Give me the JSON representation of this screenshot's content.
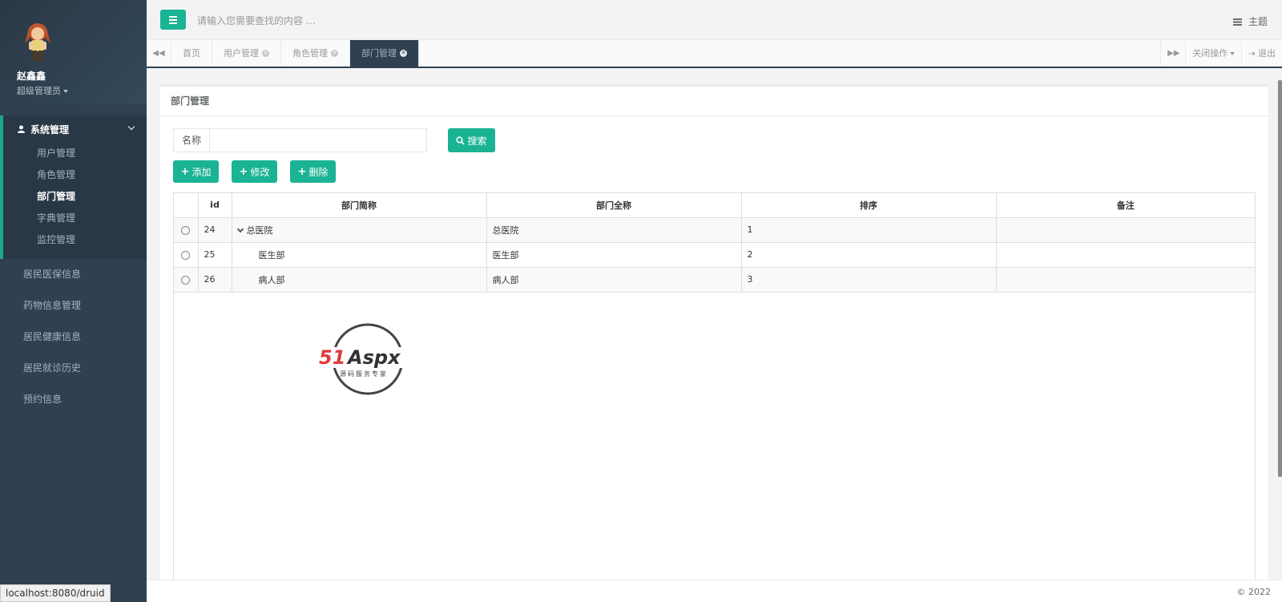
{
  "profile": {
    "name": "赵鑫鑫",
    "role": "超级管理员"
  },
  "sidebar": {
    "group": {
      "label": "系统管理",
      "items": [
        {
          "label": "用户管理",
          "active": false
        },
        {
          "label": "角色管理",
          "active": false
        },
        {
          "label": "部门管理",
          "active": true
        },
        {
          "label": "字典管理",
          "active": false
        },
        {
          "label": "监控管理",
          "active": false
        }
      ]
    },
    "items": [
      "居民医保信息",
      "药物信息管理",
      "居民健康信息",
      "居民就诊历史",
      "预约信息"
    ]
  },
  "topbar": {
    "search_placeholder": "请输入您需要查找的内容 …",
    "theme_label": "主题"
  },
  "tabs": [
    {
      "label": "首页",
      "closable": false,
      "active": false
    },
    {
      "label": "用户管理",
      "closable": true,
      "active": false
    },
    {
      "label": "角色管理",
      "closable": true,
      "active": false
    },
    {
      "label": "部门管理",
      "closable": true,
      "active": true
    }
  ],
  "tab_actions": {
    "close_ops": "关闭操作",
    "logout": "退出"
  },
  "panel": {
    "title": "部门管理",
    "search_label": "名称",
    "search_value": "",
    "search_button": "搜索",
    "actions": {
      "add": "添加",
      "edit": "修改",
      "delete": "删除"
    }
  },
  "table": {
    "columns": [
      "id",
      "部门简称",
      "部门全称",
      "排序",
      "备注"
    ],
    "rows": [
      {
        "id": "24",
        "short": "总医院",
        "full": "总医院",
        "order": "1",
        "remark": "",
        "level": 0,
        "expanded": true
      },
      {
        "id": "25",
        "short": "医生部",
        "full": "医生部",
        "order": "2",
        "remark": "",
        "level": 1
      },
      {
        "id": "26",
        "short": "病人部",
        "full": "病人部",
        "order": "3",
        "remark": "",
        "level": 1
      }
    ]
  },
  "watermark": {
    "brand": "51Aspx",
    "tagline": "源码服务专家"
  },
  "footer": {
    "copyright": "© 2022"
  },
  "statusbar": {
    "url": "localhost:8080/druid"
  },
  "colors": {
    "accent": "#1ab394",
    "sidebar": "#2f4050"
  }
}
